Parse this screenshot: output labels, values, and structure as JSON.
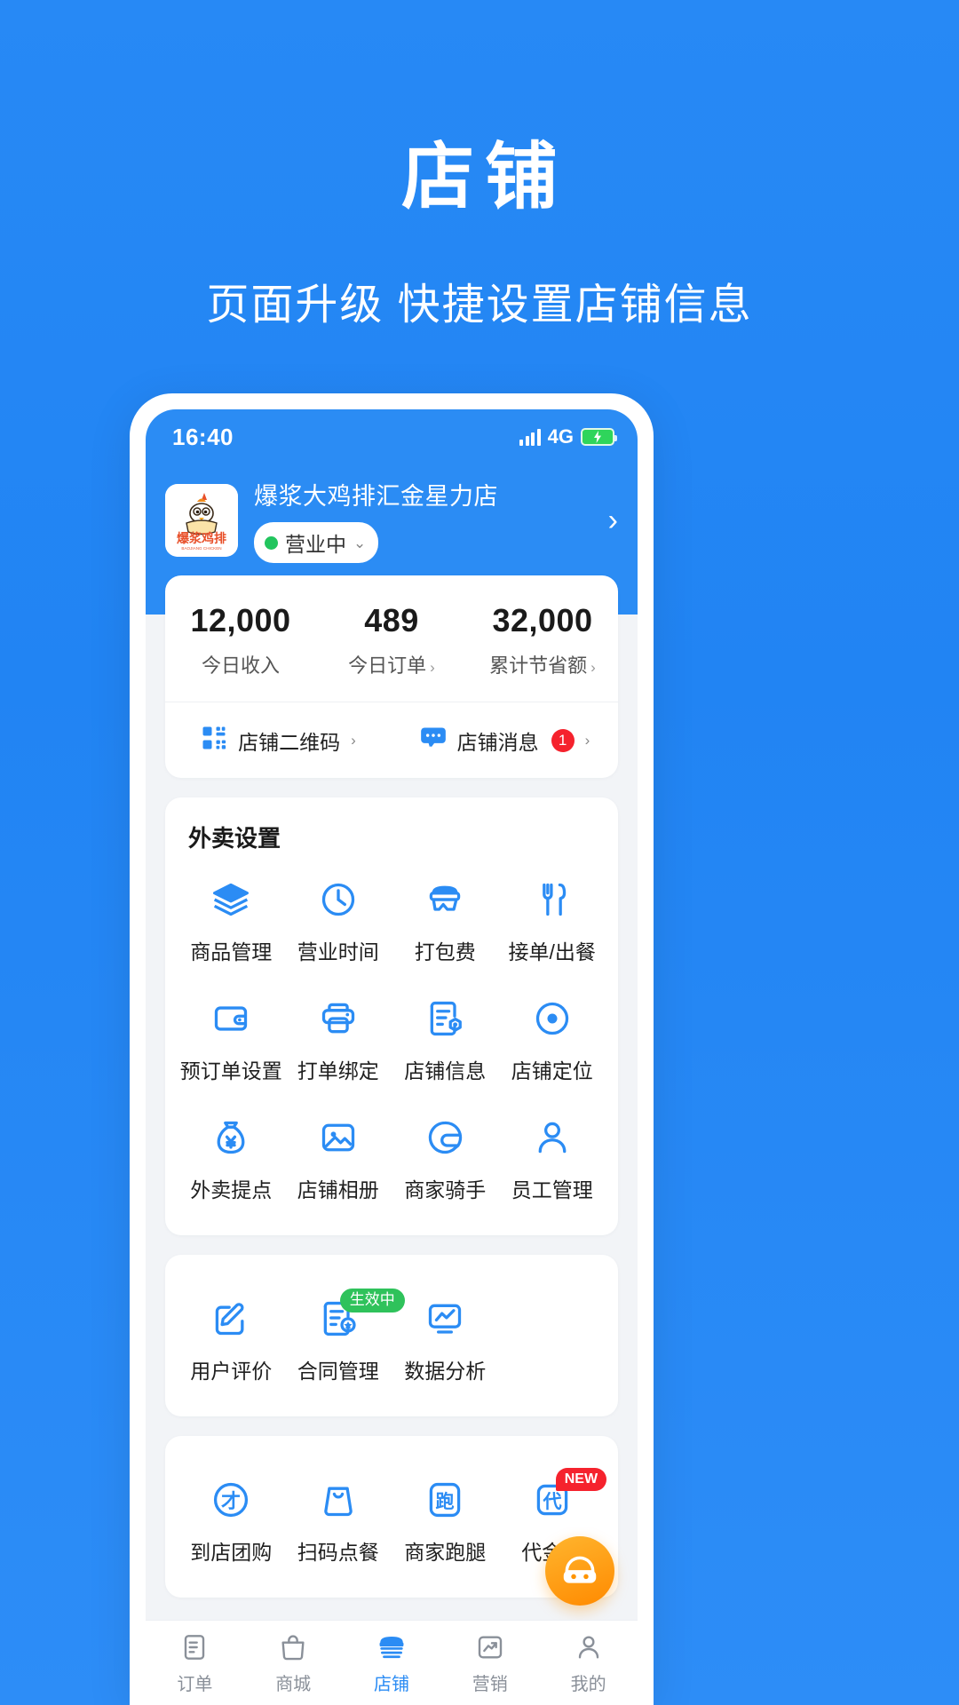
{
  "promo": {
    "title": "店铺",
    "subtitle": "页面升级 快捷设置店铺信息"
  },
  "colors": {
    "brand_blue": "#2b8cf4",
    "page_bg": "#2184f3",
    "icon_blue": "#2b8cf4",
    "green": "#2fc25b",
    "red": "#f5222d",
    "orange": "#ff9400"
  },
  "statusbar": {
    "time": "16:40",
    "network": "4G",
    "signal_icon": "signal-bars-icon",
    "battery_icon": "battery-charging-icon"
  },
  "shop_header": {
    "logo_alt": "爆浆鸡排",
    "logo_sub": "BAOJIANG CHICKEN",
    "name": "爆浆大鸡排汇金星力店",
    "status_label": "营业中",
    "status_dot_color": "#22c55e",
    "chevron": "›"
  },
  "stats": [
    {
      "value": "12,000",
      "label": "今日收入",
      "has_arrow": false
    },
    {
      "value": "489",
      "label": "今日订单",
      "has_arrow": true
    },
    {
      "value": "32,000",
      "label": "累计节省额",
      "has_arrow": true
    }
  ],
  "quick_links": [
    {
      "icon": "qrcode-icon",
      "label": "店铺二维码",
      "badge": null,
      "chevron": "›"
    },
    {
      "icon": "message-bubble-icon",
      "label": "店铺消息",
      "badge": "1",
      "chevron": "›"
    }
  ],
  "sections": [
    {
      "title": "外卖设置",
      "items": [
        {
          "icon": "layers-icon",
          "label": "商品管理",
          "badge": null
        },
        {
          "icon": "clock-icon",
          "label": "营业时间",
          "badge": null
        },
        {
          "icon": "lunchbox-icon",
          "label": "打包费",
          "badge": null
        },
        {
          "icon": "cutlery-icon",
          "label": "接单/出餐",
          "badge": null
        },
        {
          "icon": "wallet-icon",
          "label": "预订单设置",
          "badge": null
        },
        {
          "icon": "printer-icon",
          "label": "打单绑定",
          "badge": null
        },
        {
          "icon": "document-info-icon",
          "label": "店铺信息",
          "badge": null
        },
        {
          "icon": "location-pin-icon",
          "label": "店铺定位",
          "badge": null
        },
        {
          "icon": "money-bag-icon",
          "label": "外卖提点",
          "badge": null
        },
        {
          "icon": "photo-icon",
          "label": "店铺相册",
          "badge": null
        },
        {
          "icon": "helmet-icon",
          "label": "商家骑手",
          "badge": null
        },
        {
          "icon": "user-icon",
          "label": "员工管理",
          "badge": null
        }
      ]
    },
    {
      "title": "",
      "items": [
        {
          "icon": "edit-square-icon",
          "label": "用户评价",
          "badge": null
        },
        {
          "icon": "contract-icon",
          "label": "合同管理",
          "badge": "生效中",
          "badge_type": "green"
        },
        {
          "icon": "chart-monitor-icon",
          "label": "数据分析",
          "badge": null
        }
      ]
    },
    {
      "title": "",
      "items": [
        {
          "icon": "group-buy-icon",
          "label": "到店团购",
          "badge": null
        },
        {
          "icon": "scan-order-icon",
          "label": "扫码点餐",
          "badge": null
        },
        {
          "icon": "errand-icon",
          "label": "商家跑腿",
          "badge": null
        },
        {
          "icon": "voucher-icon",
          "label": "代金券",
          "badge": "NEW",
          "badge_type": "new"
        }
      ]
    }
  ],
  "fab": {
    "icon": "customer-service-icon"
  },
  "tabbar": [
    {
      "icon": "order-icon",
      "label": "订单",
      "active": false
    },
    {
      "icon": "shop-bag-icon",
      "label": "商城",
      "active": false
    },
    {
      "icon": "store-icon",
      "label": "店铺",
      "active": true
    },
    {
      "icon": "marketing-icon",
      "label": "营销",
      "active": false
    },
    {
      "icon": "profile-icon",
      "label": "我的",
      "active": false
    }
  ]
}
